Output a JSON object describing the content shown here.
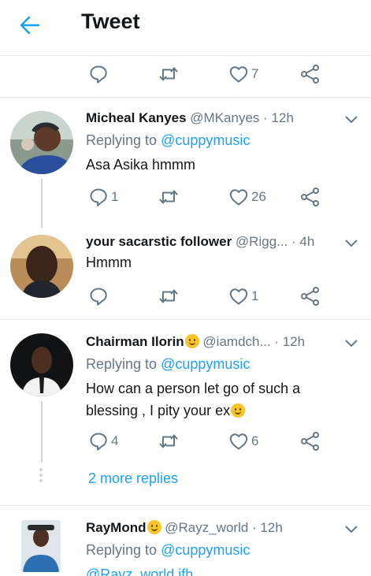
{
  "header": {
    "title": "Tweet"
  },
  "top_actions": {
    "like_count": "7"
  },
  "replies": [
    {
      "name": "Micheal Kanyes",
      "handle": "@MKanyes",
      "time": "· 12h",
      "replying_label": "Replying to",
      "replying_to": "@cuppymusic",
      "text": "Asa Asika hmmm",
      "reply_count": "1",
      "like_count": "26"
    },
    {
      "name": "your sacarstic follower",
      "handle": "@Rigg...",
      "time": "· 4h",
      "text": "Hmmm",
      "like_count": "1"
    },
    {
      "name": "Chairman Ilorin",
      "handle": "@iamdch...",
      "time": "· 12h",
      "replying_label": "Replying to",
      "replying_to": "@cuppymusic",
      "text_line1": "How can a person let go of such a",
      "text_line2": "blessing , I pity your ex",
      "reply_count": "4",
      "like_count": "6",
      "more_replies": "2 more replies"
    },
    {
      "name": "RayMond",
      "handle": "@Rayz_world",
      "time": "· 12h",
      "replying_label": "Replying to",
      "replying_to": "@cuppymusic",
      "text_partial": "@Rayz_world ifh"
    }
  ],
  "colors": {
    "accent": "#1da1f2",
    "muted": "#657786",
    "divider": "#e1e8ed",
    "thread": "#ccd6dd"
  }
}
